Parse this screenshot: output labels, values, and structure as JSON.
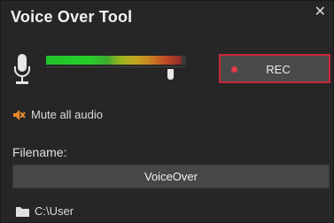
{
  "window": {
    "title": "Voice Over Tool",
    "close_glyph": "✕"
  },
  "meter": {
    "level": 0.97,
    "volume": 0.89,
    "colors": {
      "low": "#22c32a",
      "mid": "#c98a22",
      "high": "#c04a24"
    }
  },
  "record": {
    "label": "REC",
    "dot_color": "#e23a4a",
    "border_color": "#c8283a"
  },
  "mute": {
    "label": "Mute all audio",
    "icon": "speaker-mute-icon",
    "icon_color": "#e8892a"
  },
  "file": {
    "label": "Filename:",
    "value": "VoiceOver"
  },
  "folder": {
    "path": "C:\\User",
    "icon": "folder-icon"
  }
}
